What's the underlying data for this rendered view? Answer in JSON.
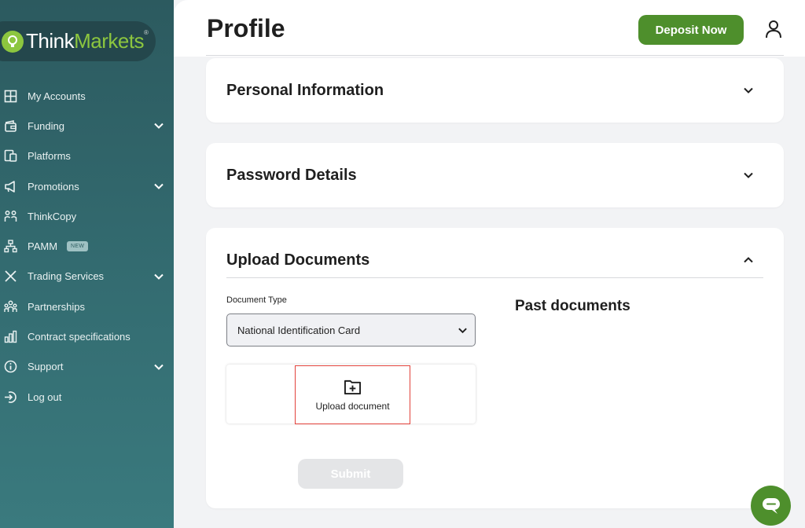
{
  "brand": {
    "think": "Think",
    "markets": "Markets",
    "reg": "®"
  },
  "sidebar": {
    "items": [
      {
        "label": "My Accounts",
        "icon": "grid-icon",
        "has_chevron": false
      },
      {
        "label": "Funding",
        "icon": "wallet-icon",
        "has_chevron": true
      },
      {
        "label": "Platforms",
        "icon": "devices-icon",
        "has_chevron": false
      },
      {
        "label": "Promotions",
        "icon": "megaphone-icon",
        "has_chevron": true
      },
      {
        "label": "ThinkCopy",
        "icon": "copy-people-icon",
        "has_chevron": false
      },
      {
        "label": "PAMM",
        "icon": "network-icon",
        "has_chevron": false,
        "badge": "NEW"
      },
      {
        "label": "Trading Services",
        "icon": "tools-icon",
        "has_chevron": true
      },
      {
        "label": "Partnerships",
        "icon": "people-icon",
        "has_chevron": false
      },
      {
        "label": "Contract specifications",
        "icon": "chart-bars-icon",
        "has_chevron": false
      },
      {
        "label": "Support",
        "icon": "info-icon",
        "has_chevron": true
      },
      {
        "label": "Log out",
        "icon": "logout-icon",
        "has_chevron": false
      }
    ]
  },
  "header": {
    "title": "Profile",
    "deposit_label": "Deposit Now"
  },
  "sections": {
    "personal": {
      "title": "Personal Information"
    },
    "password": {
      "title": "Password Details"
    },
    "upload": {
      "title": "Upload Documents",
      "document_type_label": "Document Type",
      "document_type_value": "National Identification Card",
      "upload_label": "Upload document",
      "submit_label": "Submit",
      "past_title": "Past documents"
    }
  },
  "colors": {
    "accent_green": "#4e8f2c",
    "sidebar_teal": "#336b70",
    "logo_green": "#8cc63f"
  }
}
